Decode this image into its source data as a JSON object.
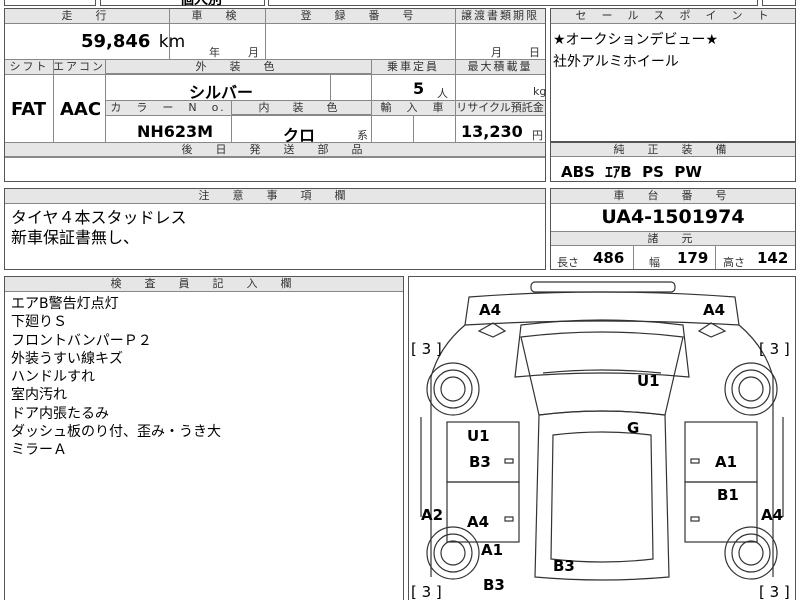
{
  "top_strip": {
    "partial_text": "個人別"
  },
  "basic": {
    "mileage_header": "走　行",
    "mileage_value": "59,846",
    "mileage_unit": "km",
    "inspection_header": "車　検",
    "inspection_year": "年",
    "inspection_month": "月",
    "registration_header": "登　録　番　号",
    "transfer_header": "譲渡書類期限",
    "transfer_month": "月",
    "transfer_day": "日"
  },
  "specs": {
    "shift_header": "シフト",
    "aircon_header": "エアコン",
    "shift_value": "FAT",
    "aircon_value": "AAC",
    "exterior_color_header": "外　装　色",
    "exterior_color_value": "シルバー",
    "capacity_header": "乗車定員",
    "capacity_value": "5",
    "capacity_unit": "人",
    "max_load_header": "最大積載量",
    "max_load_unit": "kg",
    "color_no_header": "カ　ラ　ー　N　o.",
    "color_no_value": "NH623M",
    "interior_color_header": "内　装　色",
    "interior_color_value": "クロ",
    "interior_color_suffix": "系",
    "import_header": "輸　入　車",
    "recycle_header": "リサイクル預託金",
    "recycle_value": "13,230",
    "recycle_unit": "円",
    "later_parts_header": "後　日　発　送　部　品"
  },
  "selling_points": {
    "header": "セ　ー　ル　ス　ポ　イ　ン　ト",
    "lines": [
      "★オークションデビュー★",
      "社外アルミホイール"
    ]
  },
  "genuine_equipment": {
    "header": "純　正　装　備",
    "value": "ABS  ｴｱB  PS  PW"
  },
  "notes": {
    "header": "注　意　事　項　欄",
    "lines": [
      "タイヤ４本スタッドレス",
      "新車保証書無し、"
    ]
  },
  "chassis": {
    "header": "車　台　番　号",
    "value": "UA4-1501974"
  },
  "dimensions": {
    "header": "諸　元",
    "length_label": "長さ",
    "length_value": "486",
    "width_label": "幅",
    "width_value": "179",
    "height_label": "高さ",
    "height_value": "142"
  },
  "inspector": {
    "header": "検　査　員　記　入　欄",
    "lines": [
      "エアB警告灯点灯",
      "下廻りＳ",
      "フロントバンパーＰ２",
      "外装うすい線キズ",
      "ハンドルすれ",
      "室内汚れ",
      "ドア内張たるみ",
      "ダッシュ板のり付、歪み・うき大",
      "ミラーＡ"
    ]
  },
  "damage_map": {
    "markers": [
      {
        "id": "front-left-a4",
        "text": "A4"
      },
      {
        "id": "front-right-a4",
        "text": "A4"
      },
      {
        "id": "tire-fl",
        "text": "[ 3 ]"
      },
      {
        "id": "tire-fr",
        "text": "[ 3 ]"
      },
      {
        "id": "windshield-u1",
        "text": "U1"
      },
      {
        "id": "roof-g",
        "text": "G"
      },
      {
        "id": "left-front-door-u1",
        "text": "U1"
      },
      {
        "id": "left-front-door-b3",
        "text": "B3"
      },
      {
        "id": "right-front-door-a1",
        "text": "A1"
      },
      {
        "id": "right-rear-door-b1",
        "text": "B1"
      },
      {
        "id": "left-rear-fender-a2",
        "text": "A2"
      },
      {
        "id": "left-rear-door-a4",
        "text": "A4"
      },
      {
        "id": "right-rear-a4",
        "text": "A4"
      },
      {
        "id": "left-rear-a1",
        "text": "A1"
      },
      {
        "id": "rear-b3",
        "text": "B3"
      },
      {
        "id": "left-rear-b3",
        "text": "B3"
      },
      {
        "id": "tire-rl",
        "text": "[ 3 ]"
      },
      {
        "id": "tire-rr",
        "text": "[ 3 ]"
      }
    ]
  }
}
